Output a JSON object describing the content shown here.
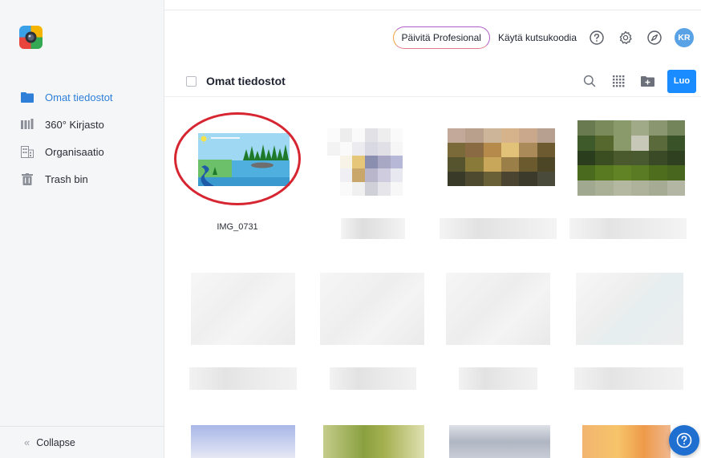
{
  "app": {
    "colors": {
      "accent": "#1a8cff",
      "active_nav": "#2d7fd8",
      "highlight_ring": "#d62631"
    }
  },
  "sidebar": {
    "logo_icon": "app-logo-icon",
    "items": [
      {
        "label": "Omat tiedostot",
        "icon": "folder-icon",
        "active": true
      },
      {
        "label": "360° Kirjasto",
        "icon": "library-icon",
        "active": false
      },
      {
        "label": "Organisaatio",
        "icon": "building-icon",
        "active": false
      },
      {
        "label": "Trash bin",
        "icon": "trash-icon",
        "active": false
      }
    ],
    "collapse_label": "Collapse"
  },
  "topbar": {
    "upgrade_label": "Päivitä Profesional",
    "invite_label": "Käytä kutsukoodia",
    "icons": [
      "help-icon",
      "settings-icon",
      "compass-icon"
    ],
    "avatar_initials": "KR"
  },
  "section": {
    "title": "Omat tiedostot",
    "create_label": "Luo",
    "tools": [
      "search-icon",
      "grid-view-icon",
      "new-folder-icon"
    ]
  },
  "files": [
    {
      "name": "IMG_0731",
      "blurred": false
    },
    {
      "name": "",
      "blurred": true
    },
    {
      "name": "",
      "blurred": true
    },
    {
      "name": "",
      "blurred": true
    },
    {
      "name": "",
      "blurred": true
    },
    {
      "name": "",
      "blurred": true
    },
    {
      "name": "",
      "blurred": true
    },
    {
      "name": "",
      "blurred": true
    },
    {
      "name": "",
      "blurred": true
    },
    {
      "name": "",
      "blurred": true
    },
    {
      "name": "",
      "blurred": true
    },
    {
      "name": "",
      "blurred": true
    }
  ]
}
